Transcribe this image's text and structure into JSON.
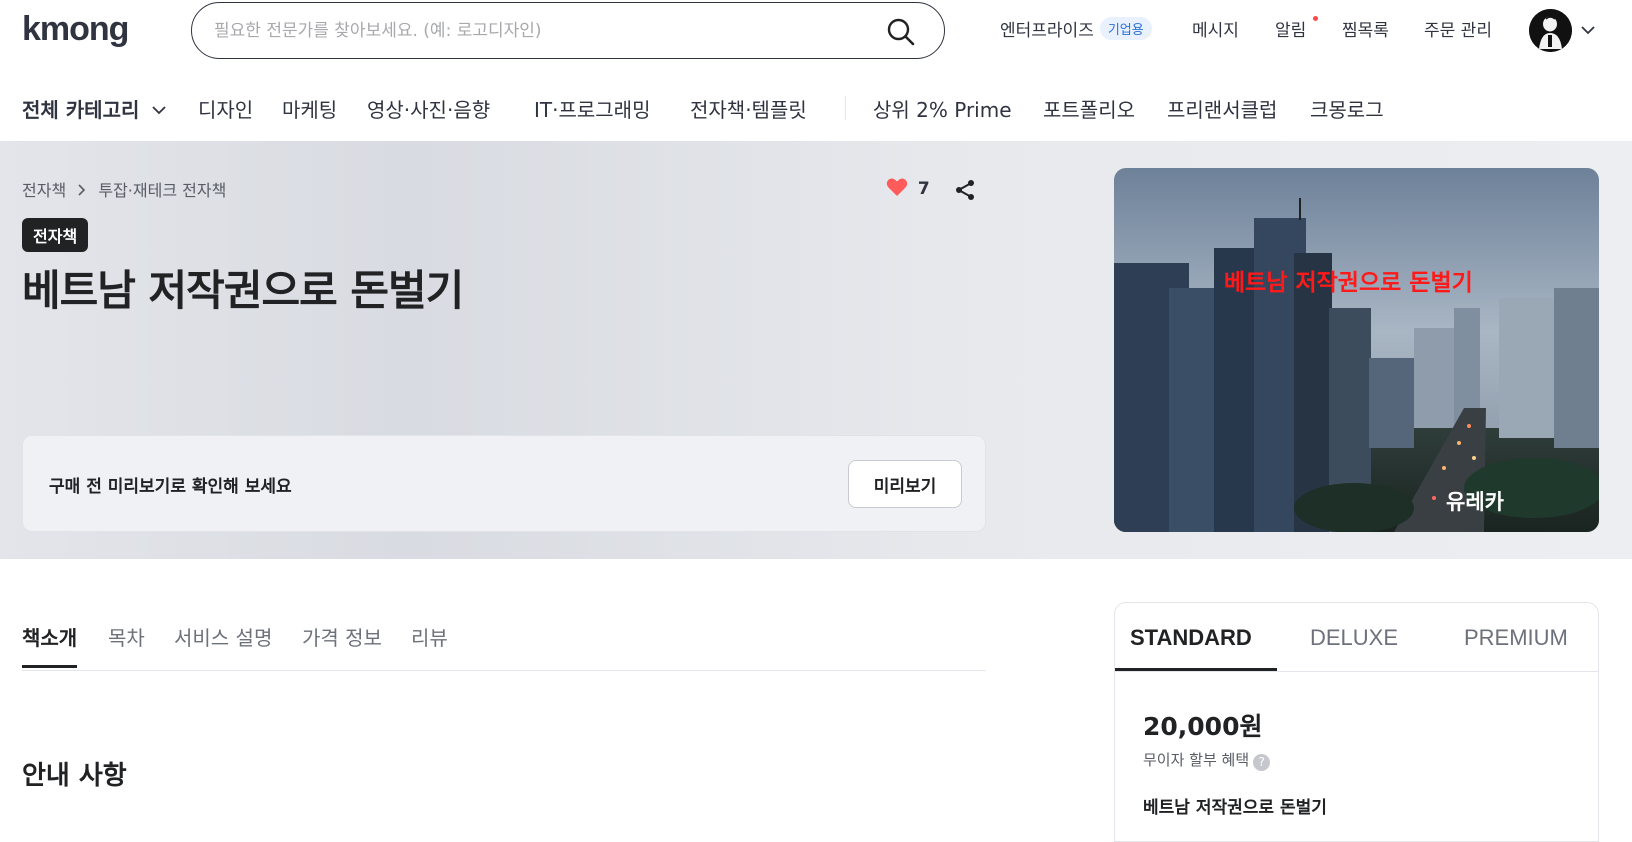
{
  "header": {
    "logo": "kmong",
    "search_placeholder": "필요한 전문가를 찾아보세요. (예: 로고디자인)",
    "nav": {
      "enterprise": "엔터프라이즈",
      "enterprise_badge": "기업용",
      "messages": "메시지",
      "notifications": "알림",
      "wishlist": "찜목록",
      "orders": "주문 관리"
    }
  },
  "categories": {
    "all": "전체 카테고리",
    "items": [
      "디자인",
      "마케팅",
      "영상·사진·음향",
      "IT·프로그래밍",
      "전자책·템플릿",
      "상위 2% Prime",
      "포트폴리오",
      "프리랜서클럽",
      "크몽로그"
    ]
  },
  "hero": {
    "breadcrumb": [
      "전자책",
      "투잡·재테크 전자책"
    ],
    "like_count": "7",
    "tag": "전자책",
    "title": "베트남 저작권으로 돈벌기",
    "preview_text": "구매 전 미리보기로 확인해 보세요",
    "preview_button": "미리보기",
    "cover_title": "베트남 저작권으로 돈벌기",
    "cover_brand": "유레카"
  },
  "content_tabs": [
    "책소개",
    "목차",
    "서비스 설명",
    "가격 정보",
    "리뷰"
  ],
  "section_title": "안내 사항",
  "pricing": {
    "tabs": [
      "STANDARD",
      "DELUXE",
      "PREMIUM"
    ],
    "price": "20,000원",
    "installment": "무이자 할부 혜택",
    "package_title": "베트남 저작권으로 돈벌기"
  },
  "colors": {
    "text_primary": "#212224",
    "heart": "#ff5b5b",
    "cover_title": "#ff1a1a",
    "enterprise_badge_text": "#2d72d9"
  }
}
